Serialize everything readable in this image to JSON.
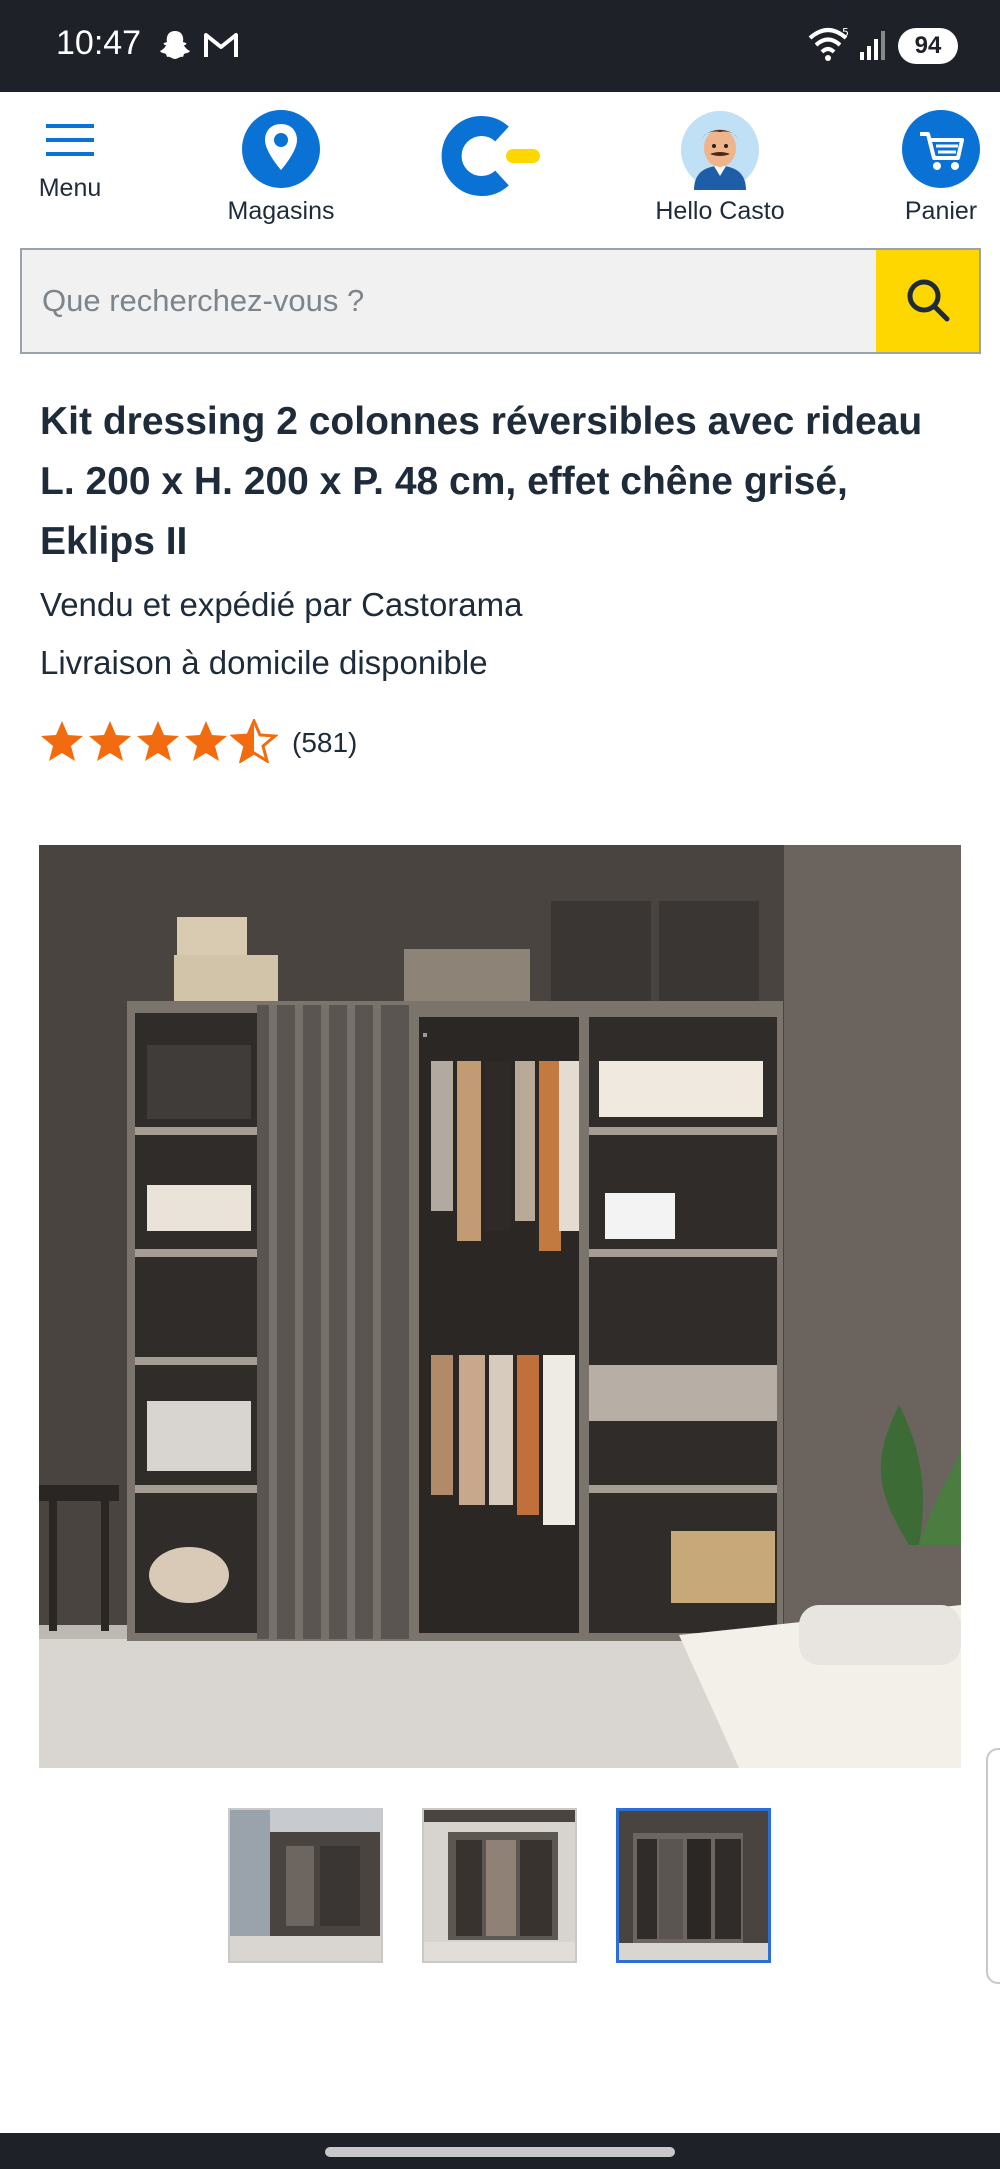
{
  "status_bar": {
    "time": "10:47",
    "battery": "94",
    "icons": [
      "snapchat-icon",
      "gmail-icon",
      "wifi-icon",
      "signal-icon"
    ]
  },
  "header": {
    "menu_label": "Menu",
    "stores_label": "Magasins",
    "account_label": "Hello Casto",
    "cart_label": "Panier",
    "brand_color": "#0a72d4",
    "accent_color": "#ffd700"
  },
  "search": {
    "placeholder": "Que recherchez-vous ?"
  },
  "product": {
    "title": "Kit dressing 2 colonnes réversibles avec rideau L. 200 x H. 200 x P. 48 cm, effet chêne grisé, Eklips II",
    "seller": "Vendu et expédié par Castorama",
    "delivery": "Livraison à domicile disponible",
    "rating_value": 4.5,
    "rating_count": "(581)",
    "star_color": "#f26b0f"
  },
  "gallery": {
    "thumbnail_count": 3,
    "active_thumbnail": 3
  }
}
